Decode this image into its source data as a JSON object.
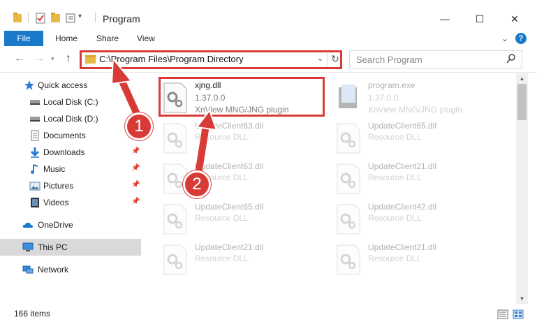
{
  "window": {
    "title": "Program",
    "minimize": "—",
    "maximize": "☐",
    "close": "✕"
  },
  "ribbon": {
    "tabs": [
      "File",
      "Home",
      "Share",
      "View"
    ],
    "expand": "⌄",
    "help": "?"
  },
  "address": {
    "path": "C:\\Program Files\\Program Directory",
    "dropdown": "⌄",
    "refresh": "↻"
  },
  "search": {
    "placeholder": "Search Program",
    "icon": "search-icon"
  },
  "sidebar": {
    "items": [
      {
        "label": "Quick access",
        "icon": "star-icon"
      },
      {
        "label": "Local Disk (C:)",
        "icon": "drive-icon"
      },
      {
        "label": "Local Disk (D:)",
        "icon": "drive-icon"
      },
      {
        "label": "Documents",
        "icon": "documents-icon"
      },
      {
        "label": "Downloads",
        "icon": "download-icon",
        "pinned": true
      },
      {
        "label": "Music",
        "icon": "music-icon",
        "pinned": true
      },
      {
        "label": "Pictures",
        "icon": "pictures-icon",
        "pinned": true
      },
      {
        "label": "Videos",
        "icon": "videos-icon",
        "pinned": true
      },
      {
        "label": "OneDrive",
        "icon": "cloud-icon"
      },
      {
        "label": "This PC",
        "icon": "computer-icon",
        "selected": true
      },
      {
        "label": "Network",
        "icon": "network-icon"
      }
    ]
  },
  "files": [
    {
      "name": "xjng.dll",
      "line1": "1.37.0.0",
      "line2": "XnView MNG/JNG plugin",
      "highlighted": true
    },
    {
      "name": "program.exe",
      "line1": "1.37.0.0",
      "line2": "XnView MNG/JNG plugin"
    },
    {
      "name": "UpdateClient63.dll",
      "line1": "Resource DLL"
    },
    {
      "name": "UpdateClient65.dll",
      "line1": "Resource DLL"
    },
    {
      "name": "UpdateClient63.dll",
      "line1": "Resource DLL"
    },
    {
      "name": "UpdateClient21.dll",
      "line1": "Resource DLL"
    },
    {
      "name": "UpdateClient65.dll",
      "line1": "Resource DLL"
    },
    {
      "name": "UpdateClient42.dll",
      "line1": "Resource DLL"
    },
    {
      "name": "UpdateClient21.dll",
      "line1": "Resource DLL"
    },
    {
      "name": "UpdateClient21.dll",
      "line1": "Resource DLL"
    }
  ],
  "status": {
    "item_count": "166 items"
  },
  "callouts": [
    "1",
    "2"
  ],
  "colors": {
    "accent": "#1979ca",
    "annotation_red": "#d83b36",
    "folder_yellow": "#e8b942"
  }
}
